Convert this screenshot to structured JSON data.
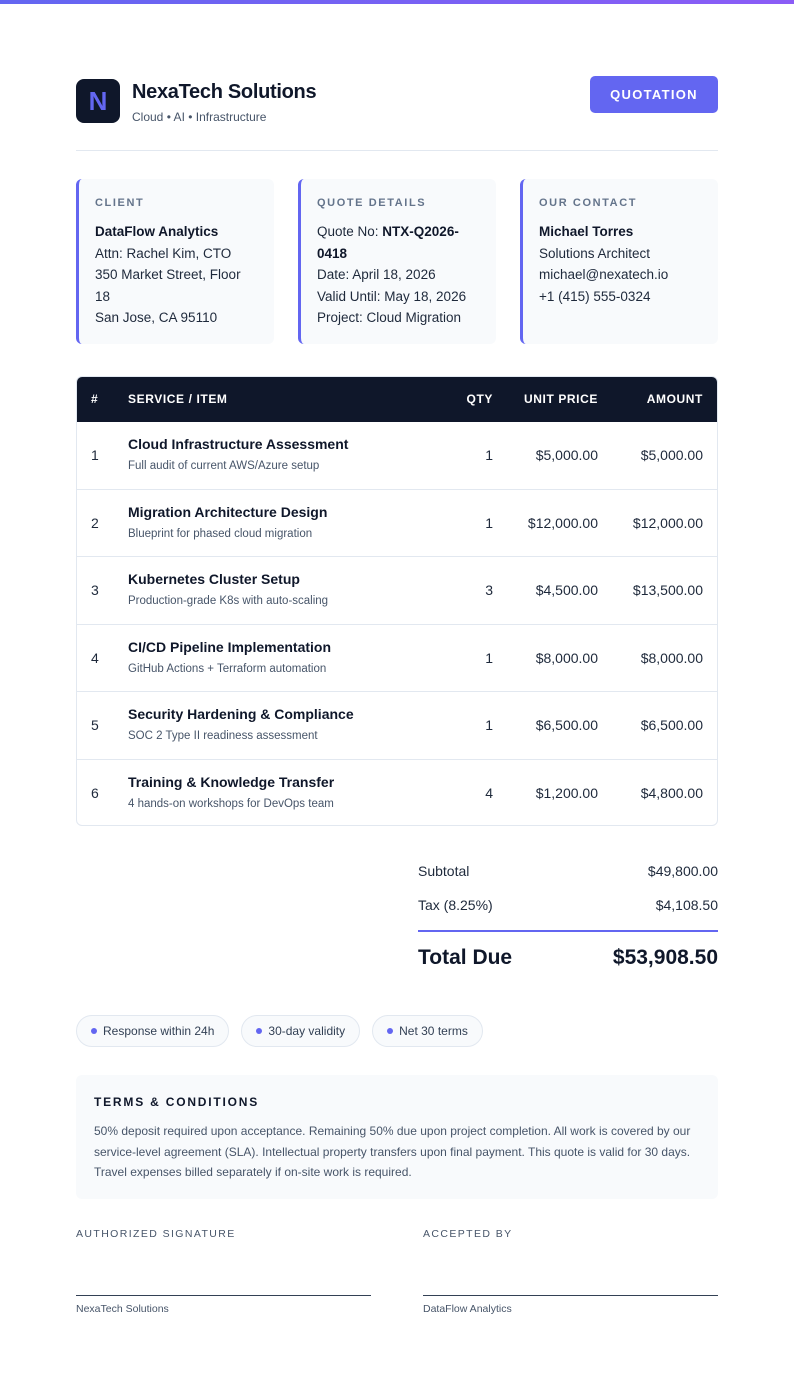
{
  "header": {
    "logo_letter": "N",
    "company": "NexaTech Solutions",
    "tagline": "Cloud • AI • Infrastructure",
    "badge": "QUOTATION"
  },
  "cards": {
    "client": {
      "title": "CLIENT",
      "name": "DataFlow Analytics",
      "attn": "Attn: Rachel Kim, CTO",
      "street1": "350 Market Street, Floor",
      "street2": "18",
      "city": "San Jose, CA 95110"
    },
    "quote": {
      "title": "QUOTE DETAILS",
      "quote_label": "Quote No: ",
      "quote_no_1": "NTX-Q2026-",
      "quote_no_2": "0418",
      "date": "Date: April 18, 2026",
      "valid": "Valid Until: May 18, 2026",
      "project": "Project: Cloud Migration"
    },
    "contact": {
      "title": "OUR CONTACT",
      "name": "Michael Torres",
      "role": "Solutions Architect",
      "email": "michael@nexatech.io",
      "phone": "+1 (415) 555-0324"
    }
  },
  "table": {
    "headers": {
      "num": "#",
      "item": "SERVICE / ITEM",
      "qty": "QTY",
      "unit": "UNIT PRICE",
      "amount": "AMOUNT"
    },
    "rows": [
      {
        "num": "1",
        "name": "Cloud Infrastructure Assessment",
        "desc": "Full audit of current AWS/Azure setup",
        "qty": "1",
        "unit": "$5,000.00",
        "amount": "$5,000.00"
      },
      {
        "num": "2",
        "name": "Migration Architecture Design",
        "desc": "Blueprint for phased cloud migration",
        "qty": "1",
        "unit": "$12,000.00",
        "amount": "$12,000.00"
      },
      {
        "num": "3",
        "name": "Kubernetes Cluster Setup",
        "desc": "Production-grade K8s with auto-scaling",
        "qty": "3",
        "unit": "$4,500.00",
        "amount": "$13,500.00"
      },
      {
        "num": "4",
        "name": "CI/CD Pipeline Implementation",
        "desc": "GitHub Actions + Terraform automation",
        "qty": "1",
        "unit": "$8,000.00",
        "amount": "$8,000.00"
      },
      {
        "num": "5",
        "name": "Security Hardening & Compliance",
        "desc": "SOC 2 Type II readiness assessment",
        "qty": "1",
        "unit": "$6,500.00",
        "amount": "$6,500.00"
      },
      {
        "num": "6",
        "name": "Training & Knowledge Transfer",
        "desc": "4 hands-on workshops for DevOps team",
        "qty": "4",
        "unit": "$1,200.00",
        "amount": "$4,800.00"
      }
    ]
  },
  "totals": {
    "subtotal_label": "Subtotal",
    "subtotal": "$49,800.00",
    "tax_label": "Tax (8.25%)",
    "tax": "$4,108.50",
    "total_label": "Total Due",
    "total": "$53,908.50"
  },
  "pills": [
    "Response within 24h",
    "30-day validity",
    "Net 30 terms"
  ],
  "terms": {
    "title": "TERMS & CONDITIONS",
    "text": "50% deposit required upon acceptance. Remaining 50% due upon project completion. All work is covered by our service-level agreement (SLA). Intellectual property transfers upon final payment. This quote is valid for 30 days. Travel expenses billed separately if on-site work is required."
  },
  "signatures": {
    "left_label": "AUTHORIZED SIGNATURE",
    "left_name": "NexaTech Solutions",
    "right_label": "ACCEPTED BY",
    "right_name": "DataFlow Analytics"
  },
  "colors": {
    "accent": "#6366f1",
    "dark": "#0f172a",
    "muted": "#475569",
    "panel": "#f8fafc"
  }
}
